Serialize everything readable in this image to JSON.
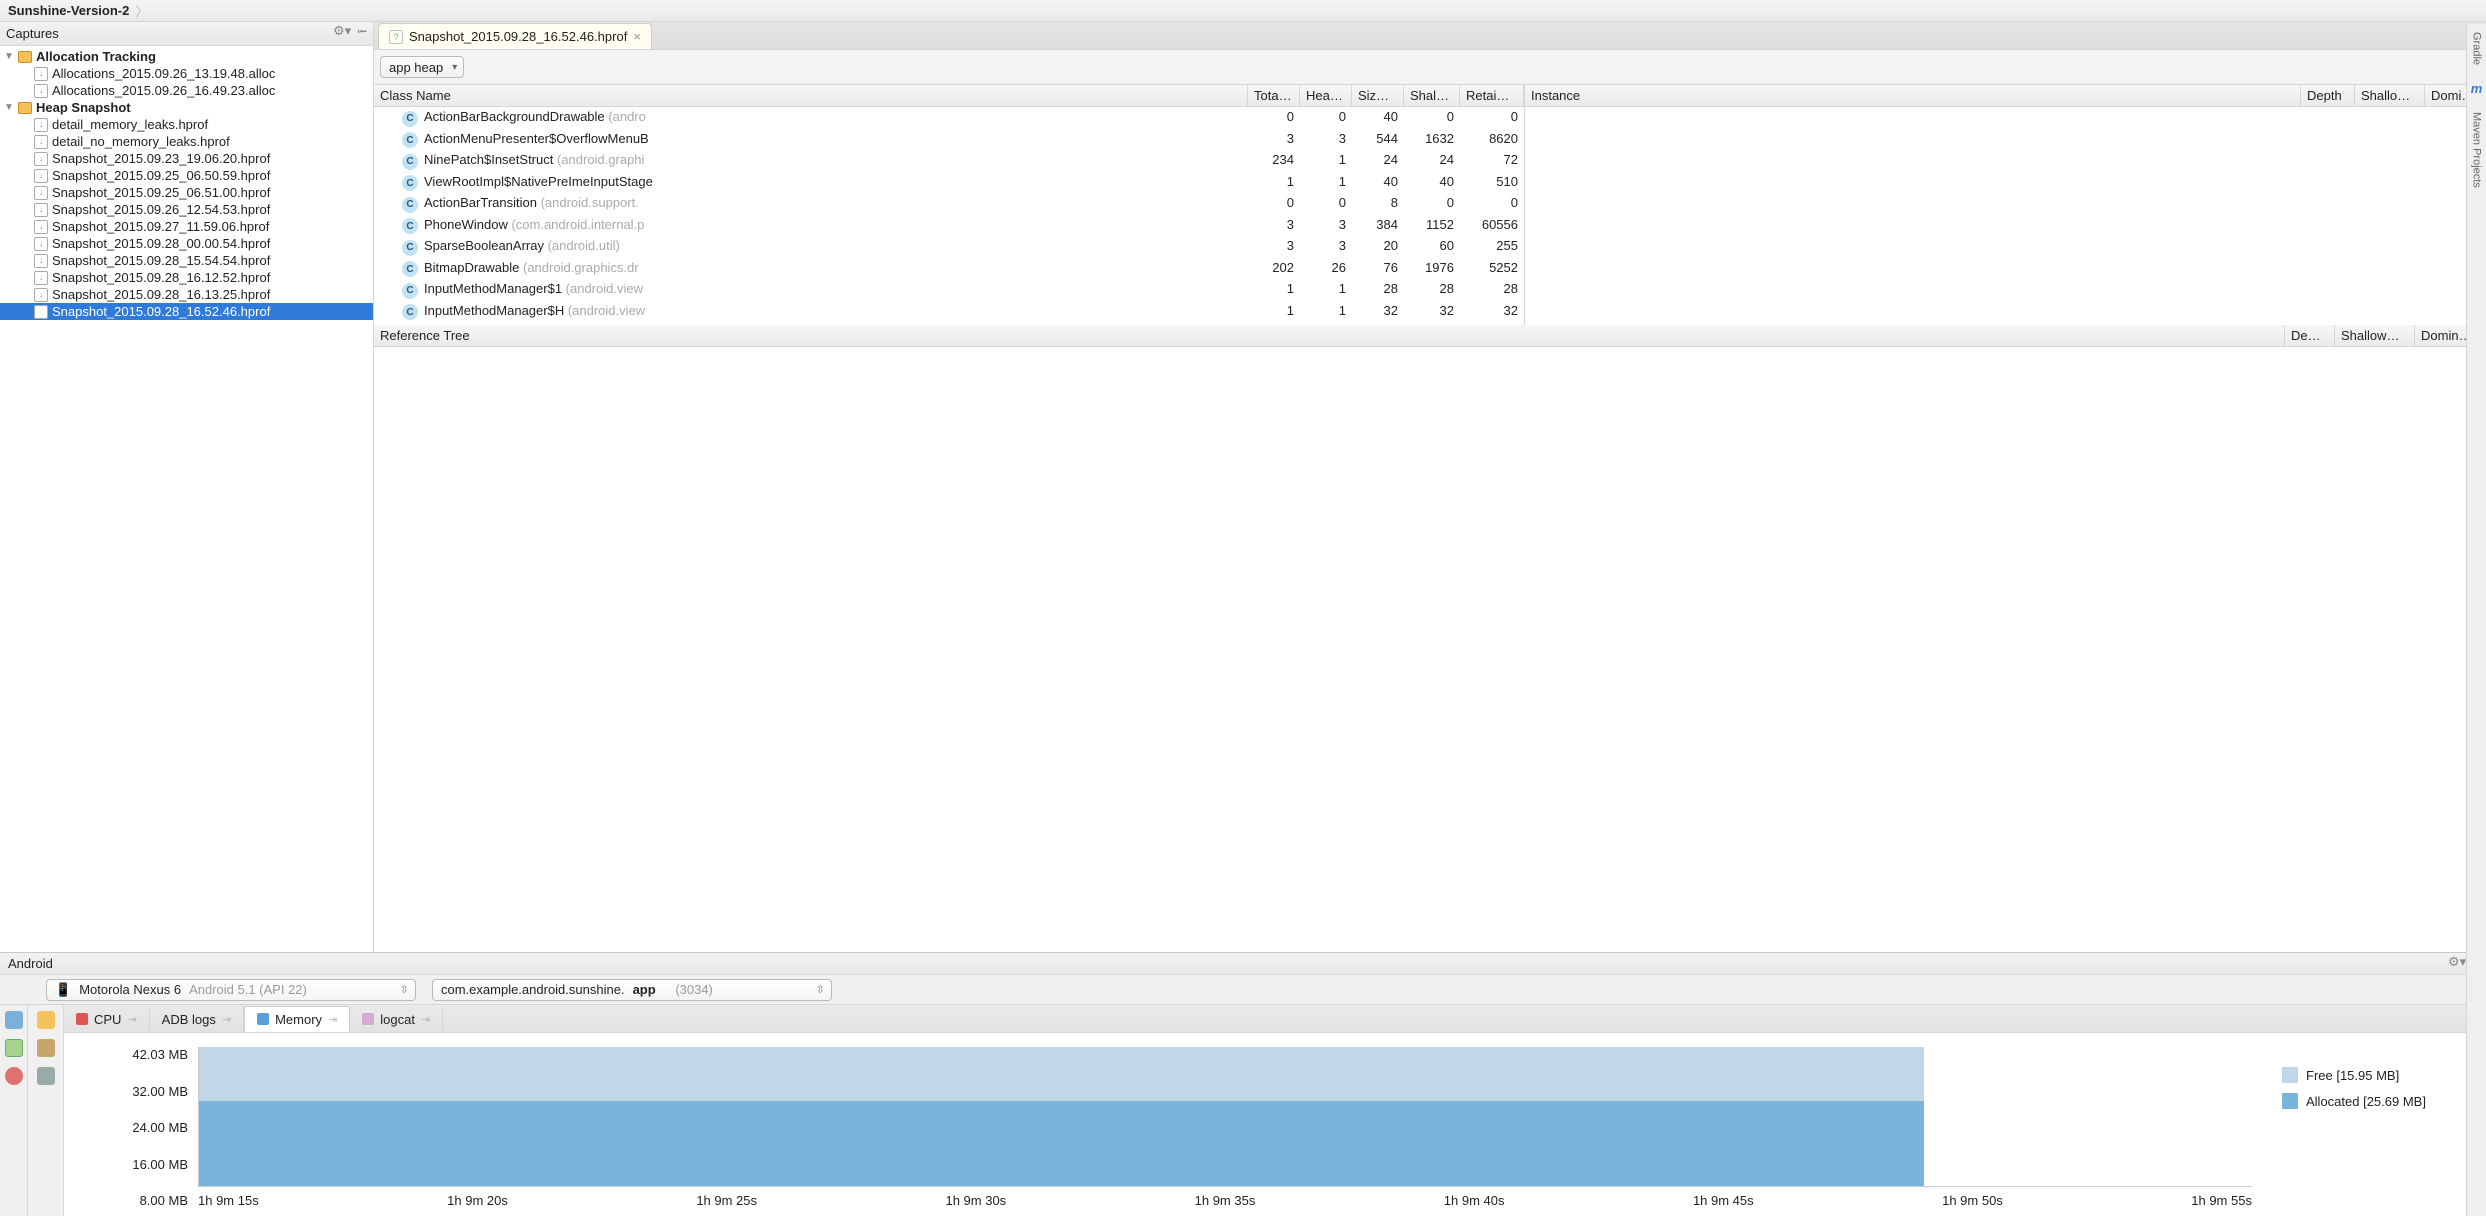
{
  "breadcrumb": {
    "project": "Sunshine-Version-2"
  },
  "captures_panel": {
    "title": "Captures",
    "groups": [
      {
        "name": "Allocation Tracking",
        "items": [
          "Allocations_2015.09.26_13.19.48.alloc",
          "Allocations_2015.09.26_16.49.23.alloc"
        ]
      },
      {
        "name": "Heap Snapshot",
        "items": [
          "detail_memory_leaks.hprof",
          "detail_no_memory_leaks.hprof",
          "Snapshot_2015.09.23_19.06.20.hprof",
          "Snapshot_2015.09.25_06.50.59.hprof",
          "Snapshot_2015.09.25_06.51.00.hprof",
          "Snapshot_2015.09.26_12.54.53.hprof",
          "Snapshot_2015.09.27_11.59.06.hprof",
          "Snapshot_2015.09.28_00.00.54.hprof",
          "Snapshot_2015.09.28_15.54.54.hprof",
          "Snapshot_2015.09.28_16.12.52.hprof",
          "Snapshot_2015.09.28_16.13.25.hprof",
          "Snapshot_2015.09.28_16.52.46.hprof"
        ],
        "selected_index": 11
      }
    ]
  },
  "editor": {
    "tab_label": "Snapshot_2015.09.28_16.52.46.hprof",
    "heap_selector": "app heap",
    "class_headers": [
      "Class Name",
      "Tota…",
      "Hea…",
      "Siz…",
      "Shal…",
      "Retai…"
    ],
    "class_rows": [
      {
        "name": "ActionBarBackgroundDrawable",
        "pkg": "(andro",
        "vals": [
          0,
          0,
          40,
          0,
          0
        ]
      },
      {
        "name": "ActionMenuPresenter$OverflowMenuB",
        "pkg": "",
        "vals": [
          3,
          3,
          544,
          1632,
          8620
        ]
      },
      {
        "name": "NinePatch$InsetStruct",
        "pkg": "(android.graphi",
        "vals": [
          234,
          1,
          24,
          24,
          72
        ]
      },
      {
        "name": "ViewRootImpl$NativePreImeInputStage",
        "pkg": "",
        "vals": [
          1,
          1,
          40,
          40,
          510
        ]
      },
      {
        "name": "ActionBarTransition",
        "pkg": "(android.support.",
        "vals": [
          0,
          0,
          8,
          0,
          0
        ]
      },
      {
        "name": "PhoneWindow",
        "pkg": "(com.android.internal.p",
        "vals": [
          3,
          3,
          384,
          1152,
          60556
        ]
      },
      {
        "name": "SparseBooleanArray",
        "pkg": "(android.util)",
        "vals": [
          3,
          3,
          20,
          60,
          255
        ]
      },
      {
        "name": "BitmapDrawable",
        "pkg": "(android.graphics.dr",
        "vals": [
          202,
          26,
          76,
          1976,
          5252
        ]
      },
      {
        "name": "InputMethodManager$1",
        "pkg": "(android.view",
        "vals": [
          1,
          1,
          28,
          28,
          28
        ]
      },
      {
        "name": "InputMethodManager$H",
        "pkg": "(android.view",
        "vals": [
          1,
          1,
          32,
          32,
          32
        ]
      }
    ],
    "instance_headers": [
      "Instance",
      "Depth",
      "Shallo…",
      "Domi…"
    ],
    "ref_headers": [
      "Reference Tree",
      "De…",
      "Shallow…",
      "Domin…"
    ]
  },
  "android_panel": {
    "title": "Android",
    "device_name": "Motorola Nexus 6",
    "device_os": "Android 5.1 (API 22)",
    "process_prefix": "com.example.android.sunshine.",
    "process_bold": "app",
    "process_pid": "(3034)",
    "tabs": [
      {
        "label": "CPU",
        "color": "#e05454"
      },
      {
        "label": "ADB logs",
        "color": null
      },
      {
        "label": "Memory",
        "color": "#5aa0dd",
        "active": true
      },
      {
        "label": "logcat",
        "color": "#d5a8d5"
      }
    ],
    "legend": {
      "free_label": "Free [15.95 MB]",
      "alloc_label": "Allocated [25.69 MB]",
      "free_color": "#c1d6e6",
      "alloc_color": "#79b4db"
    }
  },
  "right_rail": {
    "items": [
      "Gradle",
      "Maven Projects"
    ]
  },
  "chart_data": {
    "type": "area",
    "title": "",
    "xlabel": "",
    "ylabel": "",
    "ylim": [
      0,
      42.03
    ],
    "y_ticks": [
      "42.03 MB",
      "32.00 MB",
      "24.00 MB",
      "16.00 MB",
      "8.00 MB"
    ],
    "x_ticks": [
      "1h 9m 15s",
      "1h 9m 20s",
      "1h 9m 25s",
      "1h 9m 30s",
      "1h 9m 35s",
      "1h 9m 40s",
      "1h 9m 45s",
      "1h 9m 50s",
      "1h 9m 55s"
    ],
    "series": [
      {
        "name": "Allocated",
        "value_mb": 25.69,
        "color": "#79b4db"
      },
      {
        "name": "Free",
        "value_mb": 15.95,
        "color": "#c1d6e6"
      }
    ],
    "total_mb": 41.64,
    "x_extent_pct": 84
  }
}
